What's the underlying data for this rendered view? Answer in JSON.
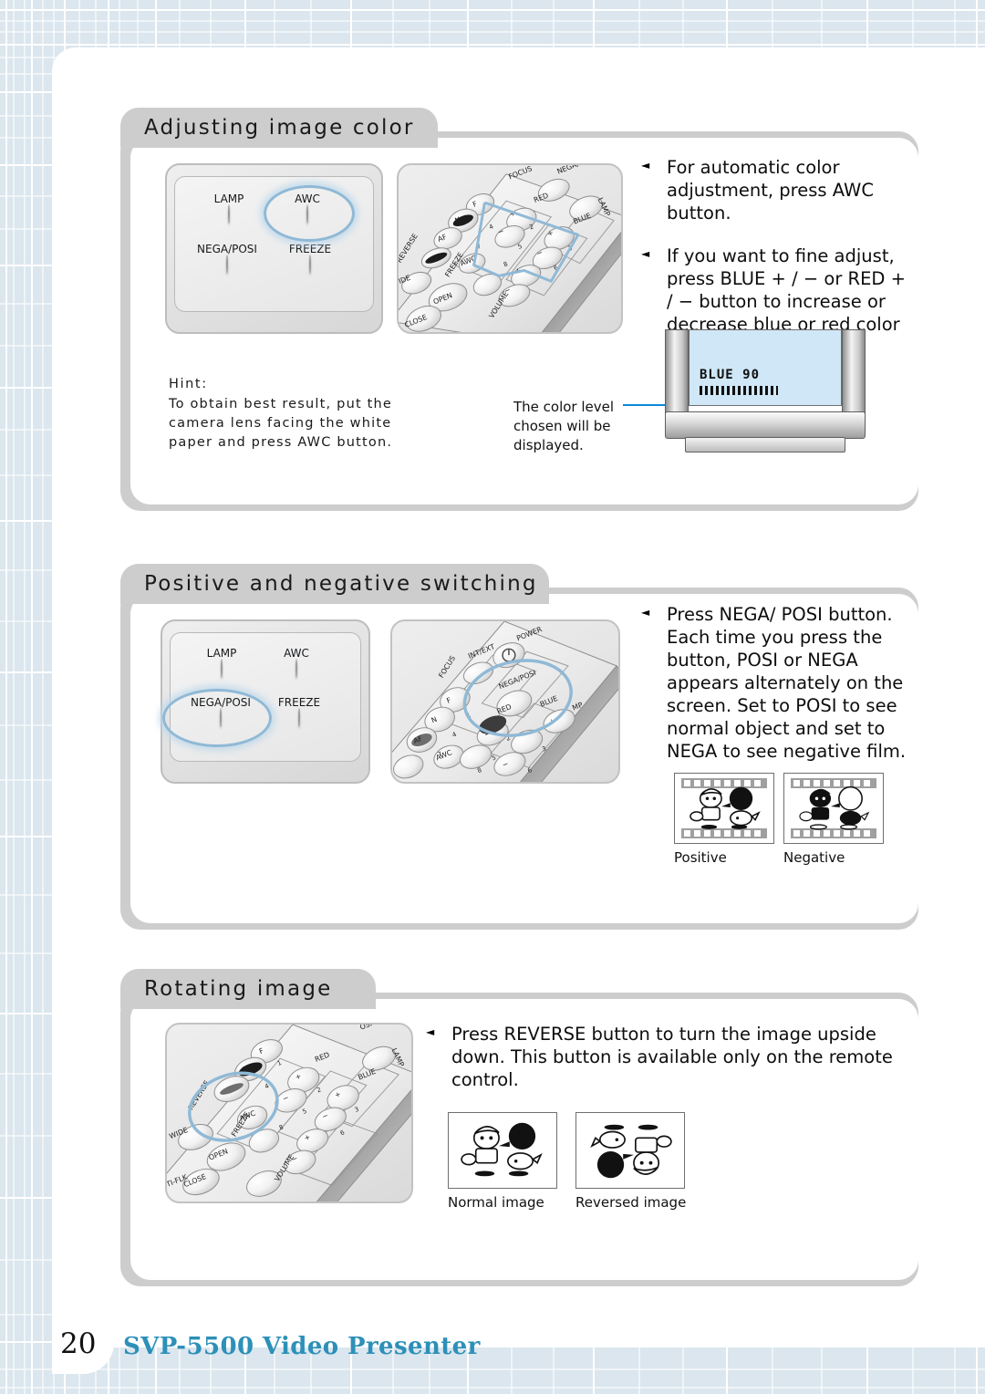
{
  "page": {
    "number": "20",
    "footer_title": "SVP-5500 Video Presenter",
    "accent_color": "#2d90b8",
    "highlight_color": "#8fb9d6",
    "callout_color": "#0a8ad6"
  },
  "sections": [
    {
      "id": "adjusting-image-color",
      "title": "Adjusting image color",
      "panel": {
        "buttons": [
          {
            "label": "LAMP",
            "highlighted": false
          },
          {
            "label": "AWC",
            "highlighted": true
          },
          {
            "label": "NEGA/POSI",
            "highlighted": false
          },
          {
            "label": "FREEZE",
            "highlighted": false
          }
        ]
      },
      "remote": {
        "caption_labels": [
          "FOCUS",
          "NEGA/POSI",
          "LAMP",
          "RED",
          "BLUE",
          "REVERSE",
          "FREEZE",
          "WIDE",
          "OPEN",
          "CLOSE",
          "VOLUME",
          "AWC",
          "F",
          "N",
          "AF"
        ],
        "numbers": [
          "1",
          "2",
          "3",
          "4",
          "5",
          "6",
          "7",
          "8"
        ],
        "highlighted_button": "RED / BLUE"
      },
      "bullets": [
        "For automatic color adjustment, press AWC button.",
        "If you want to fine adjust, press BLUE + / − or RED + / − button to increase or decrease blue or red color factor manually."
      ],
      "hint": {
        "title": "Hint:",
        "lines": [
          "To obtain best result, put the",
          "camera lens facing the white",
          "paper and press AWC button."
        ]
      },
      "callout": {
        "lines": [
          "The color level",
          "chosen will be",
          "displayed."
        ],
        "osd_text": "BLUE 90"
      }
    },
    {
      "id": "positive-and-negative-switching",
      "title": "Positive and negative switching",
      "panel": {
        "buttons": [
          {
            "label": "LAMP",
            "highlighted": false
          },
          {
            "label": "AWC",
            "highlighted": false
          },
          {
            "label": "NEGA/POSI",
            "highlighted": true
          },
          {
            "label": "FREEZE",
            "highlighted": false
          }
        ]
      },
      "remote": {
        "caption_labels": [
          "POWER",
          "INT/EXT",
          "NEGA/POSI",
          "FOCUS",
          "F",
          "N",
          "AF",
          "AWC",
          "RED",
          "BLUE",
          "LAMP"
        ],
        "numbers": [
          "1",
          "2",
          "3",
          "4",
          "5",
          "6",
          "7",
          "8"
        ],
        "highlighted_button": "NEGA/POSI"
      },
      "bullets": [
        "Press NEGA/ POSI  button. Each time you press the button, POSI or NEGA appears alternately on the screen. Set to POSI to see normal object and set to NEGA to see negative film."
      ],
      "examples": [
        {
          "caption": "Positive",
          "kind": "film-positive"
        },
        {
          "caption": "Negative",
          "kind": "film-negative"
        }
      ]
    },
    {
      "id": "rotating-image",
      "title": "Rotating image",
      "remote": {
        "caption_labels": [
          "F",
          "N",
          "REVERSE",
          "FREEZE",
          "WIDE",
          "OPEN",
          "CLOSE",
          "ANTI-FLK",
          "AWC",
          "RED",
          "BLUE",
          "VOLUME",
          "LAMP",
          "NEGA/POSI"
        ],
        "numbers": [
          "1",
          "2",
          "3",
          "4",
          "5",
          "6",
          "8"
        ],
        "highlighted_button": "REVERSE"
      },
      "bullets": [
        "Press REVERSE button to turn the image upside down. This button is available only on the remote control."
      ],
      "examples": [
        {
          "caption": "Normal image",
          "kind": "plain-normal"
        },
        {
          "caption": "Reversed image",
          "kind": "plain-reversed"
        }
      ]
    }
  ]
}
